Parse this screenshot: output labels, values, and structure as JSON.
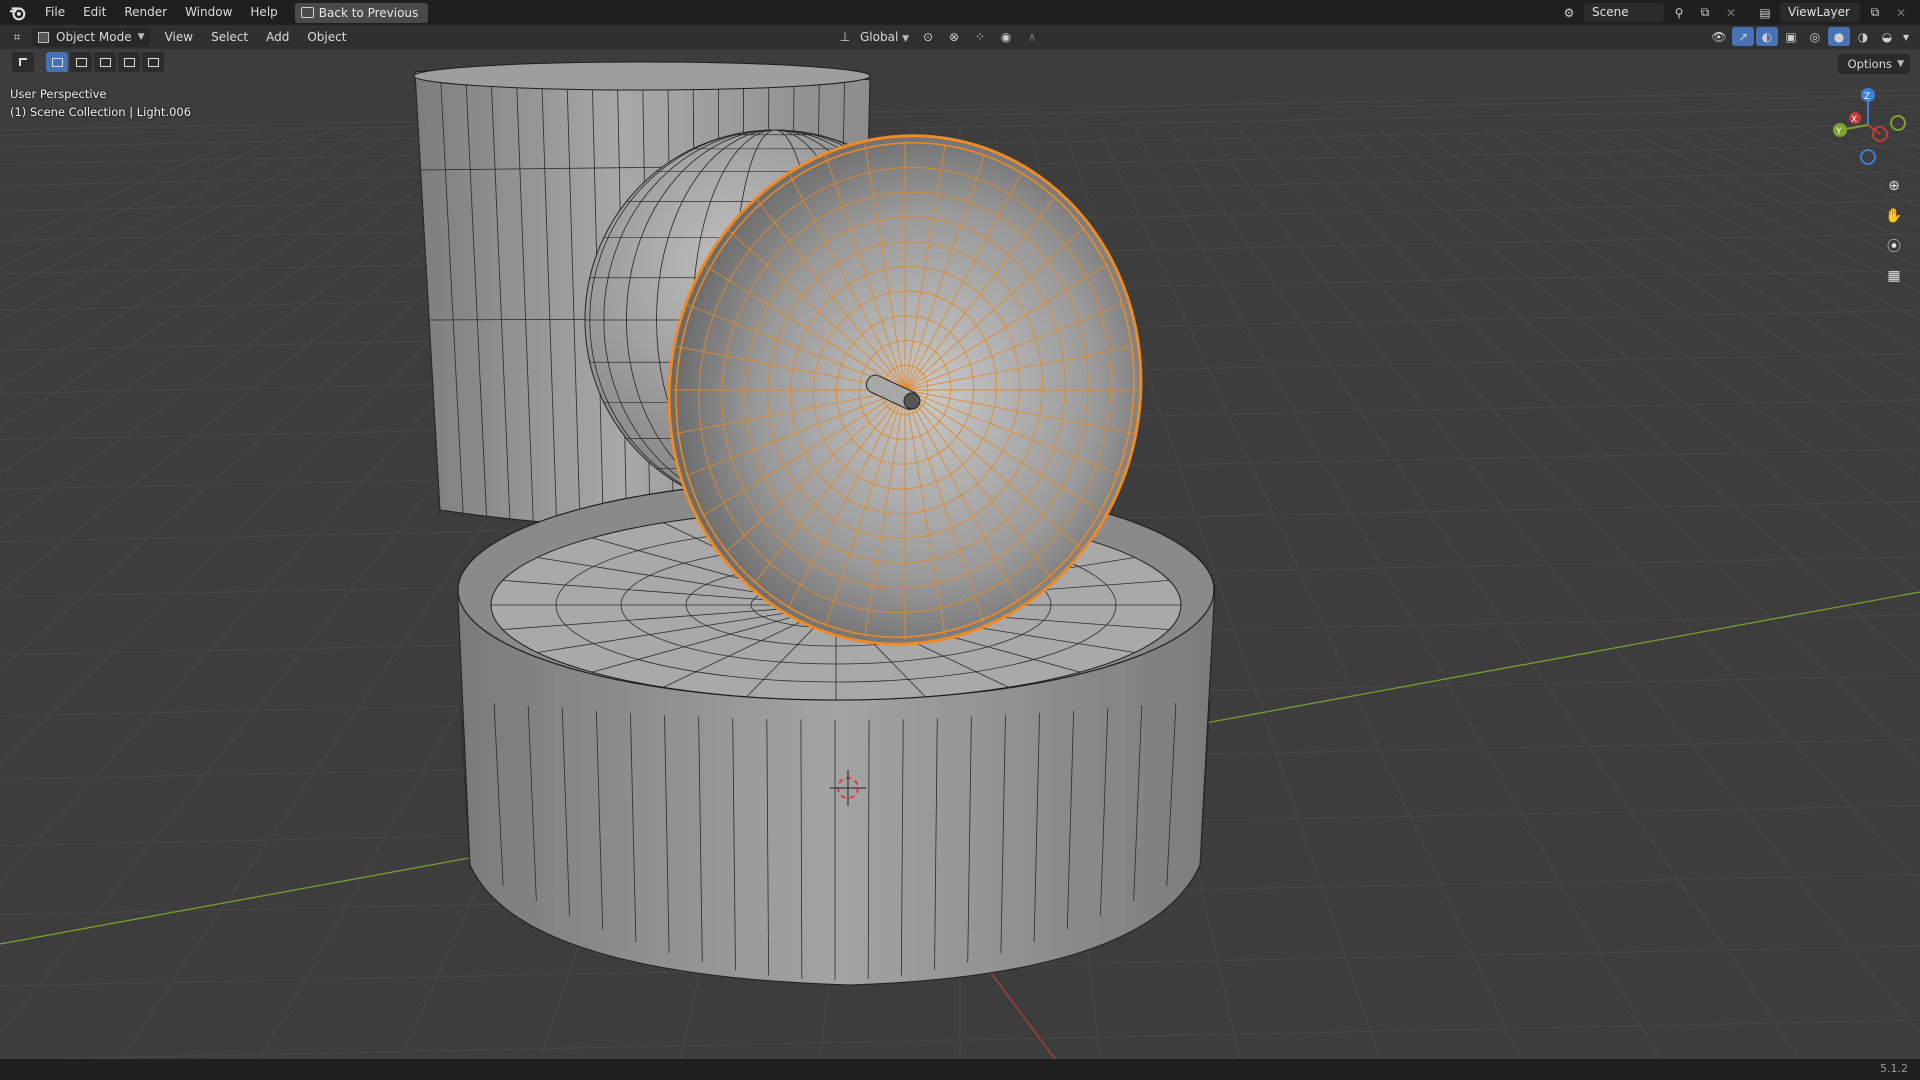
{
  "menubar": {
    "items": [
      "File",
      "Edit",
      "Render",
      "Window",
      "Help"
    ],
    "back_button": "Back to Previous"
  },
  "scene_selector": {
    "value": "Scene"
  },
  "viewlayer_selector": {
    "value": "ViewLayer"
  },
  "header": {
    "mode": "Object Mode",
    "menus": [
      "View",
      "Select",
      "Add",
      "Object"
    ],
    "transform_orientation": "Global",
    "options_label": "Options"
  },
  "viewport": {
    "perspective_label": "User Perspective",
    "collection_label": "(1) Scene Collection | Light.006",
    "gizmo_axes": [
      "X",
      "Y",
      "Z"
    ]
  },
  "statusbar": {
    "version": "5.1.2"
  },
  "colors": {
    "selection_orange": "#f08a24",
    "axis_x": "#c43a3a",
    "axis_y": "#7ea32a",
    "axis_z": "#3a7fd8",
    "active_tool": "#4772b3"
  }
}
